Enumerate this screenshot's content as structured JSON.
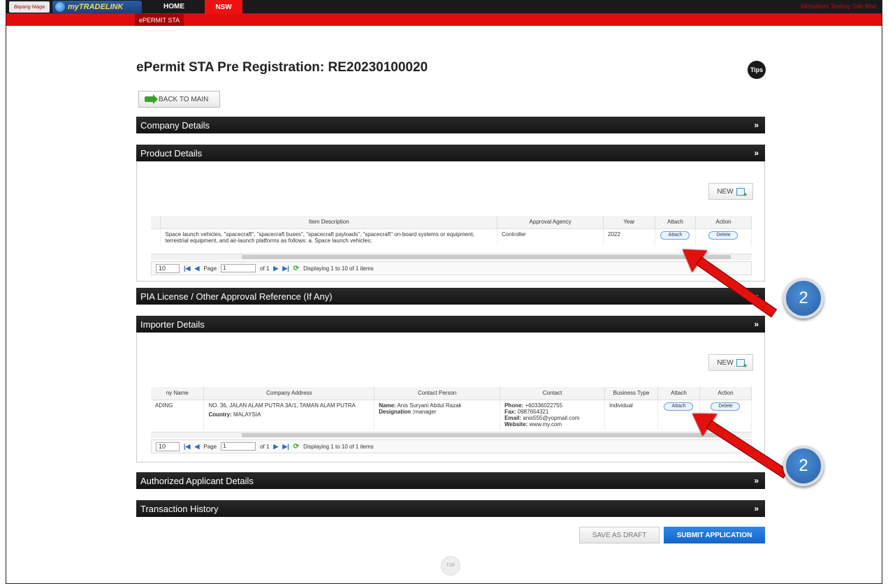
{
  "topbar": {
    "logo1": "Bayang Niaga",
    "logo2": "myTRADELINK",
    "nav_home": "HOME",
    "nav_nsw": "NSW",
    "user_text": "Mitsubishi Testing Sdn Bhd",
    "subtab": "ePERMIT STA"
  },
  "header": {
    "title": "ePermit STA Pre Registration: RE20230100020",
    "tips": "Tips",
    "back": "BACK TO MAIN"
  },
  "sections": {
    "company": "Company Details",
    "product": "Product Details",
    "pia": "PIA License / Other Approval Reference (If Any)",
    "importer": "Importer Details",
    "authorized": "Authorized Applicant Details",
    "history": "Transaction History"
  },
  "product": {
    "new": "NEW",
    "headers": [
      "Item Description",
      "Approval Agency",
      "Year",
      "Attach",
      "Action"
    ],
    "row": {
      "desc": "Space launch vehicles, \"spacecraft\", \"spacecraft buses\", \"spacecraft payloads\", \"spacecraft\" on-board systems or equipment, terrestrial equipment, and air-launch platforms as follows: a. Space launch vehicles;",
      "agency": "Controller",
      "year": "2022",
      "attach": "Attach",
      "action": "Delete"
    },
    "pager": {
      "size": "10",
      "page_label": "Page",
      "page": "1",
      "of": "of 1",
      "display": "Displaying 1 to 10 of 1 items"
    }
  },
  "importer": {
    "new": "NEW",
    "headers": [
      "ny Name",
      "Company Address",
      "Contact Person",
      "Contact",
      "Business Type",
      "Attach",
      "Action"
    ],
    "row": {
      "name": "ADING",
      "address": "NO. 36, JALAN ALAM PUTRA 3A/1, TAMAN ALAM PUTRA",
      "country_label": "Country:",
      "country": "MALAYSIA",
      "contact_name_label": "Name:",
      "contact_name": "Anis Suryani Abdul Razak",
      "designation_label": "Designation :",
      "designation": "manager",
      "phone_label": "Phone:",
      "phone": "+60336022755",
      "fax_label": "Fax:",
      "fax": "0987654321",
      "email_label": "Email:",
      "email": "anis555@yopmail.com",
      "website_label": "Website:",
      "website": "www.my.com",
      "business": "Individual",
      "attach": "Attach",
      "action": "Delete"
    },
    "pager": {
      "size": "10",
      "page_label": "Page",
      "page": "1",
      "of": "of 1",
      "display": "Displaying 1 to 10 of 1 items"
    }
  },
  "callouts": {
    "badge1": "2",
    "badge2": "2"
  },
  "footer": {
    "draft": "SAVE AS DRAFT",
    "submit": "SUBMIT APPLICATION",
    "top": "TOP"
  },
  "colors": {
    "accent_red": "#e10d0d",
    "submit_blue": "#1566c8",
    "header_dark": "#141414"
  }
}
